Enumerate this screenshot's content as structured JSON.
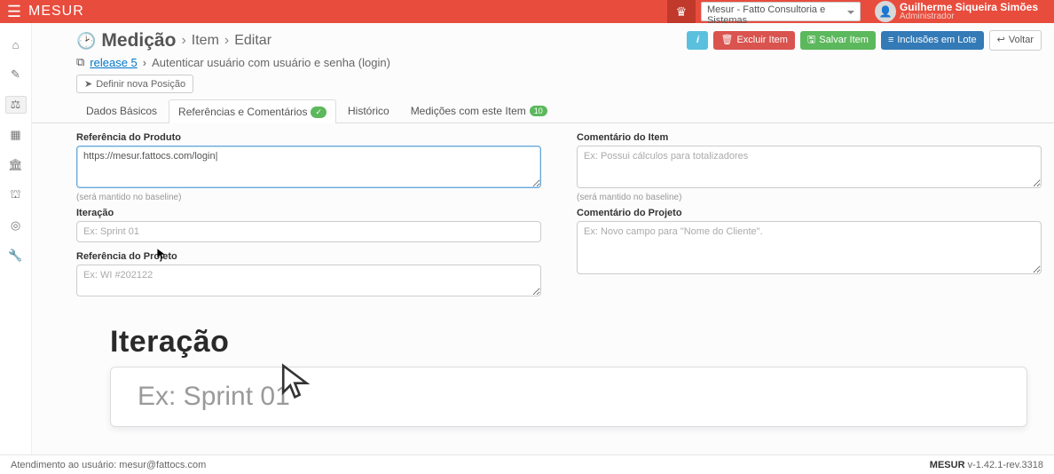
{
  "topbar": {
    "brand": "MESUR",
    "tenant": "Mesur - Fatto Consultoria e Sistemas",
    "user_name": "Guilherme Siqueira Simões",
    "user_role": "Administrador"
  },
  "breadcrumb": {
    "title": "Medição",
    "level2": "Item",
    "level3": "Editar"
  },
  "subcrumb": {
    "release_link": "release 5",
    "item_name": "Autenticar usuário com usuário e senha (login)"
  },
  "toolbar": {
    "define_position": "Definir nova Posição"
  },
  "actions": {
    "delete": "Excluir Item",
    "save": "Salvar Item",
    "batch": "Inclusões em Lote",
    "back": "Voltar"
  },
  "tabs": {
    "t1": "Dados Básicos",
    "t2": "Referências e Comentários",
    "t3": "Histórico",
    "t4": "Medições com este Item",
    "t4_count": "10"
  },
  "fields": {
    "ref_produto_label": "Referência do Produto",
    "ref_produto_value": "https://mesur.fattocs.com/login|",
    "ref_helper": "(será mantido no baseline)",
    "iteracao_label": "Iteração",
    "iteracao_placeholder": "Ex: Sprint 01",
    "ref_projeto_label": "Referência do Projeto",
    "ref_projeto_placeholder": "Ex: WI #202122",
    "comentario_item_label": "Comentário do Item",
    "comentario_item_placeholder": "Ex: Possui cálculos para totalizadores",
    "comentario_projeto_label": "Comentário do Projeto",
    "comentario_projeto_placeholder": "Ex: Novo campo para \"Nome do Cliente\"."
  },
  "zoom": {
    "label": "Iteração",
    "placeholder": "Ex: Sprint 01"
  },
  "footer": {
    "support": "Atendimento ao usuário: mesur@fattocs.com",
    "app": "MESUR",
    "version": " v-1.42.1-rev.3318"
  }
}
